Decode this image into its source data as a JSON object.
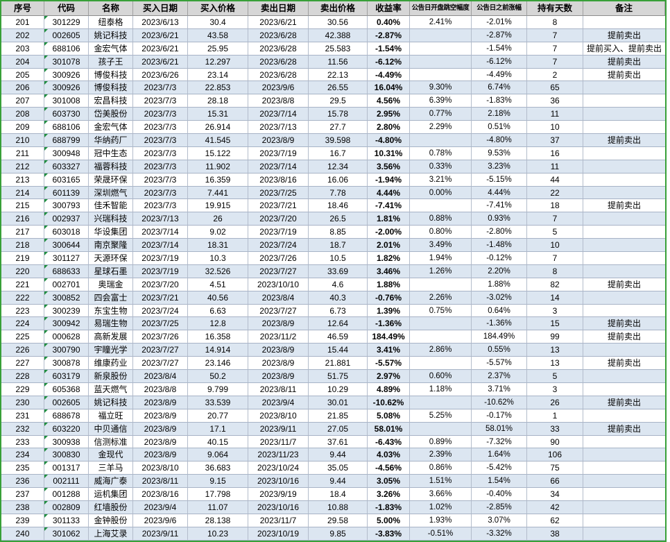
{
  "table": {
    "columns": [
      {
        "key": "seq",
        "label": "序号"
      },
      {
        "key": "code",
        "label": "代码"
      },
      {
        "key": "name",
        "label": "名称"
      },
      {
        "key": "buy-date",
        "label": "买入日期"
      },
      {
        "key": "buy-price",
        "label": "买入价格"
      },
      {
        "key": "sell-date",
        "label": "卖出日期"
      },
      {
        "key": "sell-price",
        "label": "卖出价格"
      },
      {
        "key": "return-rate",
        "label": "收益率"
      },
      {
        "key": "announce-open-gap",
        "label": "公告日开盘跳空幅度"
      },
      {
        "key": "pre-announce-gain",
        "label": "公告日之前涨幅"
      },
      {
        "key": "holding-days",
        "label": "持有天数"
      },
      {
        "key": "note",
        "label": "备注"
      }
    ],
    "rows": [
      [
        "201",
        "301229",
        "纽泰格",
        "2023/6/13",
        "30.4",
        "2023/6/21",
        "30.56",
        "0.40%",
        "2.41%",
        "-2.01%",
        "8",
        ""
      ],
      [
        "202",
        "002605",
        "姚记科技",
        "2023/6/21",
        "43.58",
        "2023/6/28",
        "42.388",
        "-2.87%",
        "",
        "-2.87%",
        "7",
        "提前卖出"
      ],
      [
        "203",
        "688106",
        "金宏气体",
        "2023/6/21",
        "25.95",
        "2023/6/28",
        "25.583",
        "-1.54%",
        "",
        "-1.54%",
        "7",
        "提前买入、提前卖出"
      ],
      [
        "204",
        "301078",
        "孩子王",
        "2023/6/21",
        "12.297",
        "2023/6/28",
        "11.56",
        "-6.12%",
        "",
        "-6.12%",
        "7",
        "提前卖出"
      ],
      [
        "205",
        "300926",
        "博俊科技",
        "2023/6/26",
        "23.14",
        "2023/6/28",
        "22.13",
        "-4.49%",
        "",
        "-4.49%",
        "2",
        "提前卖出"
      ],
      [
        "206",
        "300926",
        "博俊科技",
        "2023/7/3",
        "22.853",
        "2023/9/6",
        "26.55",
        "16.04%",
        "9.30%",
        "6.74%",
        "65",
        ""
      ],
      [
        "207",
        "301008",
        "宏昌科技",
        "2023/7/3",
        "28.18",
        "2023/8/8",
        "29.5",
        "4.56%",
        "6.39%",
        "-1.83%",
        "36",
        ""
      ],
      [
        "208",
        "603730",
        "岱美股份",
        "2023/7/3",
        "15.31",
        "2023/7/14",
        "15.78",
        "2.95%",
        "0.77%",
        "2.18%",
        "11",
        ""
      ],
      [
        "209",
        "688106",
        "金宏气体",
        "2023/7/3",
        "26.914",
        "2023/7/13",
        "27.7",
        "2.80%",
        "2.29%",
        "0.51%",
        "10",
        ""
      ],
      [
        "210",
        "688799",
        "华纳药厂",
        "2023/7/3",
        "41.545",
        "2023/8/9",
        "39.598",
        "-4.80%",
        "",
        "-4.80%",
        "37",
        "提前卖出"
      ],
      [
        "211",
        "300948",
        "冠中生态",
        "2023/7/3",
        "15.122",
        "2023/7/19",
        "16.7",
        "10.31%",
        "0.78%",
        "9.53%",
        "16",
        ""
      ],
      [
        "212",
        "603327",
        "福蓉科技",
        "2023/7/3",
        "11.902",
        "2023/7/14",
        "12.34",
        "3.56%",
        "0.33%",
        "3.23%",
        "11",
        ""
      ],
      [
        "213",
        "603165",
        "荣晟环保",
        "2023/7/3",
        "16.359",
        "2023/8/16",
        "16.06",
        "-1.94%",
        "3.21%",
        "-5.15%",
        "44",
        ""
      ],
      [
        "214",
        "601139",
        "深圳燃气",
        "2023/7/3",
        "7.441",
        "2023/7/25",
        "7.78",
        "4.44%",
        "0.00%",
        "4.44%",
        "22",
        ""
      ],
      [
        "215",
        "300793",
        "佳禾智能",
        "2023/7/3",
        "19.915",
        "2023/7/21",
        "18.46",
        "-7.41%",
        "",
        "-7.41%",
        "18",
        "提前卖出"
      ],
      [
        "216",
        "002937",
        "兴瑞科技",
        "2023/7/13",
        "26",
        "2023/7/20",
        "26.5",
        "1.81%",
        "0.88%",
        "0.93%",
        "7",
        ""
      ],
      [
        "217",
        "603018",
        "华设集团",
        "2023/7/14",
        "9.02",
        "2023/7/19",
        "8.85",
        "-2.00%",
        "0.80%",
        "-2.80%",
        "5",
        ""
      ],
      [
        "218",
        "300644",
        "南京聚隆",
        "2023/7/14",
        "18.31",
        "2023/7/24",
        "18.7",
        "2.01%",
        "3.49%",
        "-1.48%",
        "10",
        ""
      ],
      [
        "219",
        "301127",
        "天源环保",
        "2023/7/19",
        "10.3",
        "2023/7/26",
        "10.5",
        "1.82%",
        "1.94%",
        "-0.12%",
        "7",
        ""
      ],
      [
        "220",
        "688633",
        "星球石墨",
        "2023/7/19",
        "32.526",
        "2023/7/27",
        "33.69",
        "3.46%",
        "1.26%",
        "2.20%",
        "8",
        ""
      ],
      [
        "221",
        "002701",
        "奥瑞金",
        "2023/7/20",
        "4.51",
        "2023/10/10",
        "4.6",
        "1.88%",
        "",
        "1.88%",
        "82",
        "提前卖出"
      ],
      [
        "222",
        "300852",
        "四会富士",
        "2023/7/21",
        "40.56",
        "2023/8/4",
        "40.3",
        "-0.76%",
        "2.26%",
        "-3.02%",
        "14",
        ""
      ],
      [
        "223",
        "300239",
        "东宝生物",
        "2023/7/24",
        "6.63",
        "2023/7/27",
        "6.73",
        "1.39%",
        "0.75%",
        "0.64%",
        "3",
        ""
      ],
      [
        "224",
        "300942",
        "易瑞生物",
        "2023/7/25",
        "12.8",
        "2023/8/9",
        "12.64",
        "-1.36%",
        "",
        "-1.36%",
        "15",
        "提前卖出"
      ],
      [
        "225",
        "000628",
        "高新发展",
        "2023/7/26",
        "16.358",
        "2023/11/2",
        "46.59",
        "184.49%",
        "",
        "184.49%",
        "99",
        "提前卖出"
      ],
      [
        "226",
        "300790",
        "宇瞳光学",
        "2023/7/27",
        "14.914",
        "2023/8/9",
        "15.44",
        "3.41%",
        "2.86%",
        "0.55%",
        "13",
        ""
      ],
      [
        "227",
        "300878",
        "维康药业",
        "2023/7/27",
        "23.146",
        "2023/8/9",
        "21.881",
        "-5.57%",
        "",
        "-5.57%",
        "13",
        "提前卖出"
      ],
      [
        "228",
        "603179",
        "新泉股份",
        "2023/8/4",
        "50.2",
        "2023/8/9",
        "51.75",
        "2.97%",
        "0.60%",
        "2.37%",
        "5",
        ""
      ],
      [
        "229",
        "605368",
        "蓝天燃气",
        "2023/8/8",
        "9.799",
        "2023/8/11",
        "10.29",
        "4.89%",
        "1.18%",
        "3.71%",
        "3",
        ""
      ],
      [
        "230",
        "002605",
        "姚记科技",
        "2023/8/9",
        "33.539",
        "2023/9/4",
        "30.01",
        "-10.62%",
        "",
        "-10.62%",
        "26",
        "提前卖出"
      ],
      [
        "231",
        "688678",
        "福立旺",
        "2023/8/9",
        "20.77",
        "2023/8/10",
        "21.85",
        "5.08%",
        "5.25%",
        "-0.17%",
        "1",
        ""
      ],
      [
        "232",
        "603220",
        "中贝通信",
        "2023/8/9",
        "17.1",
        "2023/9/11",
        "27.05",
        "58.01%",
        "",
        "58.01%",
        "33",
        "提前卖出"
      ],
      [
        "233",
        "300938",
        "信测标准",
        "2023/8/9",
        "40.15",
        "2023/11/7",
        "37.61",
        "-6.43%",
        "0.89%",
        "-7.32%",
        "90",
        ""
      ],
      [
        "234",
        "300830",
        "金现代",
        "2023/8/9",
        "9.064",
        "2023/11/23",
        "9.44",
        "4.03%",
        "2.39%",
        "1.64%",
        "106",
        ""
      ],
      [
        "235",
        "001317",
        "三羊马",
        "2023/8/10",
        "36.683",
        "2023/10/24",
        "35.05",
        "-4.56%",
        "0.86%",
        "-5.42%",
        "75",
        ""
      ],
      [
        "236",
        "002111",
        "威海广泰",
        "2023/8/11",
        "9.15",
        "2023/10/16",
        "9.44",
        "3.05%",
        "1.51%",
        "1.54%",
        "66",
        ""
      ],
      [
        "237",
        "001288",
        "运机集团",
        "2023/8/16",
        "17.798",
        "2023/9/19",
        "18.4",
        "3.26%",
        "3.66%",
        "-0.40%",
        "34",
        ""
      ],
      [
        "238",
        "002809",
        "红墙股份",
        "2023/9/4",
        "11.07",
        "2023/10/16",
        "10.88",
        "-1.83%",
        "1.02%",
        "-2.85%",
        "42",
        ""
      ],
      [
        "239",
        "301133",
        "金钟股份",
        "2023/9/6",
        "28.138",
        "2023/11/7",
        "29.58",
        "5.00%",
        "1.93%",
        "3.07%",
        "62",
        ""
      ],
      [
        "240",
        "301062",
        "上海艾录",
        "2023/9/11",
        "10.23",
        "2023/10/19",
        "9.85",
        "-3.83%",
        "-0.51%",
        "-3.32%",
        "38",
        ""
      ]
    ]
  },
  "colors": {
    "selection_border": "#38a038",
    "header_bg": "#d6d6d6",
    "stripe_bg": "#dce6f1",
    "indicator_green": "#1e8e3e"
  },
  "icons": {
    "number_as_text_indicator": "green-corner-triangle"
  }
}
